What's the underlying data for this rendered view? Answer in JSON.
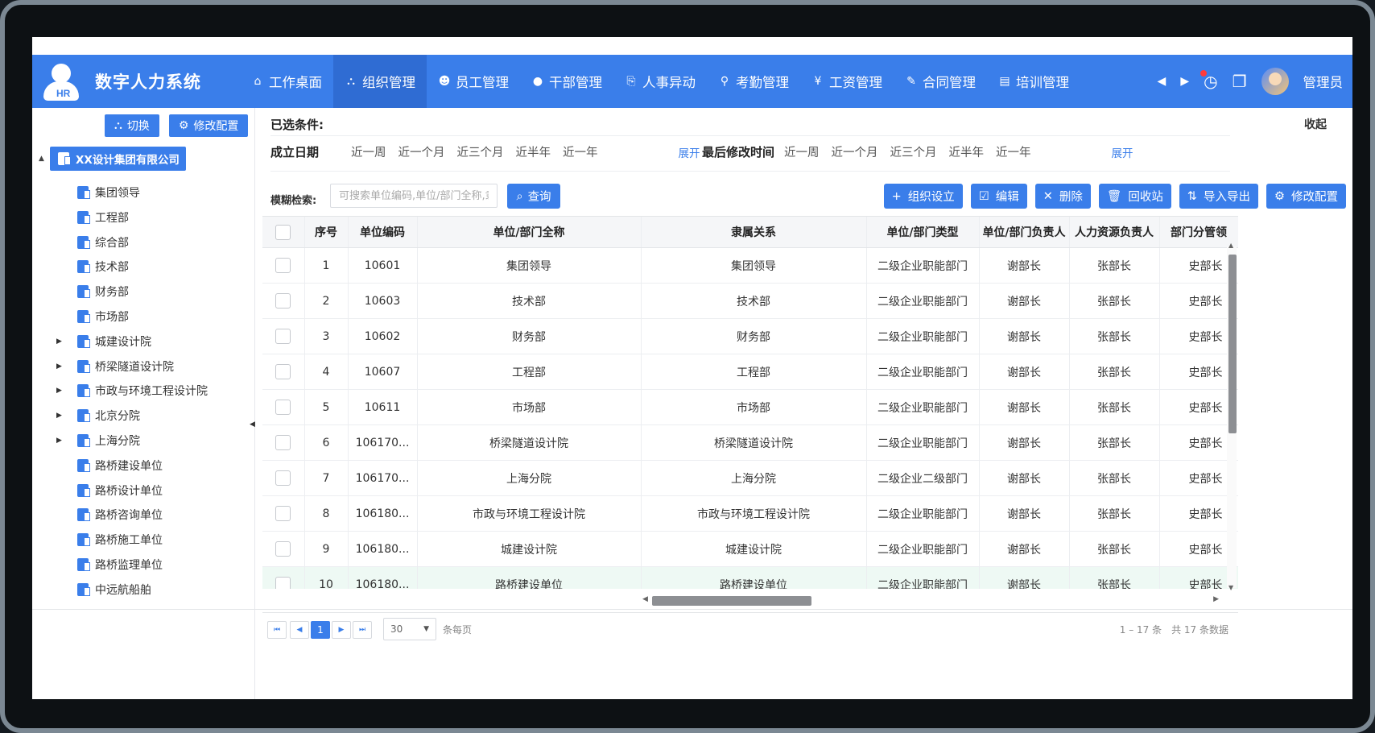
{
  "app": {
    "title": "数字人力系统",
    "logo_text": "HR"
  },
  "nav": {
    "items": [
      {
        "label": "工作桌面",
        "icon": "home-icon",
        "glyph": "⌂"
      },
      {
        "label": "组织管理",
        "icon": "org-tree-icon",
        "glyph": "⛬",
        "active": true
      },
      {
        "label": "员工管理",
        "icon": "employee-icon",
        "glyph": "☻"
      },
      {
        "label": "干部管理",
        "icon": "cadre-icon",
        "glyph": "●"
      },
      {
        "label": "人事异动",
        "icon": "transfer-icon",
        "glyph": "⎘"
      },
      {
        "label": "考勤管理",
        "icon": "location-pin-icon",
        "glyph": "⚲"
      },
      {
        "label": "工资管理",
        "icon": "yen-icon",
        "glyph": "¥"
      },
      {
        "label": "合同管理",
        "icon": "contract-icon",
        "glyph": "✎"
      },
      {
        "label": "培训管理",
        "icon": "training-icon",
        "glyph": "▤"
      }
    ],
    "prev_glyph": "◀",
    "next_glyph": "▶",
    "clock_glyph": "◷",
    "window_glyph": "❐",
    "user_name": "管理员"
  },
  "sidebar": {
    "switch_label": "切换",
    "config_label": "修改配置",
    "root": "XX设计集团有限公司",
    "nodes": [
      {
        "label": "集团领导",
        "expandable": false
      },
      {
        "label": "工程部",
        "expandable": false
      },
      {
        "label": "综合部",
        "expandable": false
      },
      {
        "label": "技术部",
        "expandable": false
      },
      {
        "label": "财务部",
        "expandable": false
      },
      {
        "label": "市场部",
        "expandable": false
      },
      {
        "label": "城建设计院",
        "expandable": true
      },
      {
        "label": "桥梁隧道设计院",
        "expandable": true
      },
      {
        "label": "市政与环境工程设计院",
        "expandable": true
      },
      {
        "label": "北京分院",
        "expandable": true
      },
      {
        "label": "上海分院",
        "expandable": true
      },
      {
        "label": "路桥建设单位",
        "expandable": false
      },
      {
        "label": "路桥设计单位",
        "expandable": false
      },
      {
        "label": "路桥咨询单位",
        "expandable": false
      },
      {
        "label": "路桥施工单位",
        "expandable": false
      },
      {
        "label": "路桥监理单位",
        "expandable": false
      },
      {
        "label": "中远航船舶",
        "expandable": false
      }
    ]
  },
  "filters": {
    "selected_label": "已选条件:",
    "collapse_label": "收起",
    "found_date": {
      "label": "成立日期",
      "options": [
        "近一周",
        "近一个月",
        "近三个月",
        "近半年",
        "近一年"
      ],
      "expand": "展开"
    },
    "modified_time": {
      "label": "最后修改时间",
      "options": [
        "近一周",
        "近一个月",
        "近三个月",
        "近半年",
        "近一年"
      ],
      "expand": "展开"
    }
  },
  "search": {
    "label": "模糊检索:",
    "placeholder": "可搜索单位编码,单位/部门全称,隶",
    "query_label": "查询"
  },
  "actions": [
    {
      "label": "组织设立",
      "glyph": "+"
    },
    {
      "label": "编辑",
      "glyph": "☑"
    },
    {
      "label": "删除",
      "glyph": "✕"
    },
    {
      "label": "回收站",
      "glyph": "🗑"
    },
    {
      "label": "导入导出",
      "glyph": "⇅"
    },
    {
      "label": "修改配置",
      "glyph": "⚙"
    }
  ],
  "table": {
    "columns": [
      "序号",
      "单位编码",
      "单位/部门全称",
      "隶属关系",
      "单位/部门类型",
      "单位/部门负责人",
      "人力资源负责人",
      "部门分管领"
    ],
    "rows": [
      [
        "1",
        "10601",
        "集团领导",
        "集团领导",
        "二级企业职能部门",
        "谢部长",
        "张部长",
        "史部长"
      ],
      [
        "2",
        "10603",
        "技术部",
        "技术部",
        "二级企业职能部门",
        "谢部长",
        "张部长",
        "史部长"
      ],
      [
        "3",
        "10602",
        "财务部",
        "财务部",
        "二级企业职能部门",
        "谢部长",
        "张部长",
        "史部长"
      ],
      [
        "4",
        "10607",
        "工程部",
        "工程部",
        "二级企业职能部门",
        "谢部长",
        "张部长",
        "史部长"
      ],
      [
        "5",
        "10611",
        "市场部",
        "市场部",
        "二级企业职能部门",
        "谢部长",
        "张部长",
        "史部长"
      ],
      [
        "6",
        "106170...",
        "桥梁隧道设计院",
        "桥梁隧道设计院",
        "二级企业职能部门",
        "谢部长",
        "张部长",
        "史部长"
      ],
      [
        "7",
        "106170...",
        "上海分院",
        "上海分院",
        "二级企业二级部门",
        "谢部长",
        "张部长",
        "史部长"
      ],
      [
        "8",
        "106180...",
        "市政与环境工程设计院",
        "市政与环境工程设计院",
        "二级企业职能部门",
        "谢部长",
        "张部长",
        "史部长"
      ],
      [
        "9",
        "106180...",
        "城建设计院",
        "城建设计院",
        "二级企业职能部门",
        "谢部长",
        "张部长",
        "史部长"
      ],
      [
        "10",
        "106180...",
        "路桥建设单位",
        "路桥建设单位",
        "二级企业职能部门",
        "谢部长",
        "张部长",
        "史部长"
      ]
    ],
    "selected_row": 10
  },
  "pager": {
    "current": "1",
    "page_size": "30",
    "per_page_label": "条每页",
    "info": "1 – 17 条　共 17 条数据"
  },
  "colors": {
    "primary": "#3a7eea",
    "active_nav": "#2f6cd3",
    "selected_row": "#eef9f4"
  }
}
